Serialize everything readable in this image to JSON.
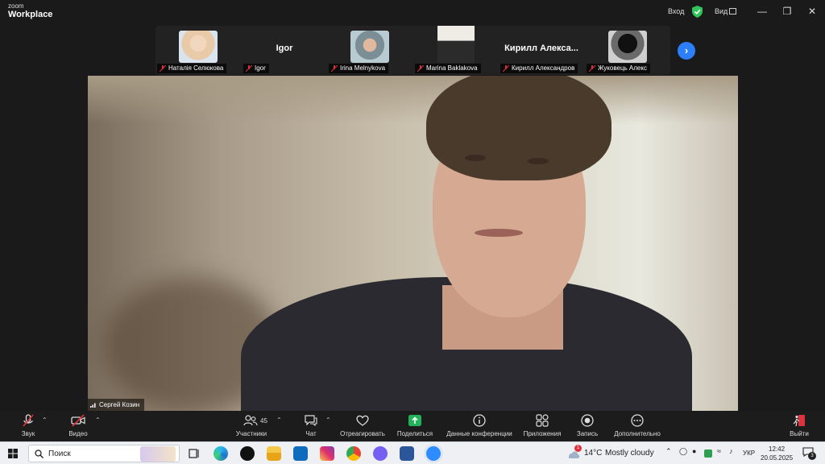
{
  "app": {
    "logo_top": "zoom",
    "logo_main": "Workplace"
  },
  "titlebar": {
    "login": "Вход",
    "view": "Вид",
    "shield_color": "#2ec55b"
  },
  "participants": [
    {
      "name": "Наталія Селюкова",
      "display": "photo",
      "thumb_color": "#e8c9a8"
    },
    {
      "name": "Igor",
      "display": "Igor",
      "thumb_color": ""
    },
    {
      "name": "Irina Melnykova",
      "display": "photo",
      "thumb_color": "#9fb8c4"
    },
    {
      "name": "Marina Baklakova",
      "display": "photo",
      "thumb_color": "#c9c2b4"
    },
    {
      "name": "Кирилл Александров",
      "display": "Кирилл  Алекса...",
      "thumb_color": ""
    },
    {
      "name": "Жуковець Алекс",
      "display": "photo",
      "thumb_color": "#3a3a3a"
    }
  ],
  "main_video": {
    "speaker_name": "Сергей Козин"
  },
  "controls": {
    "audio": "Звук",
    "video": "Видео",
    "participants": "Участники",
    "participants_count": "45",
    "chat": "Чат",
    "react": "Отреагировать",
    "share": "Поделиться",
    "meeting_info": "Данные конференции",
    "apps": "Приложения",
    "record": "Запись",
    "more": "Дополнительно",
    "leave": "Выйти",
    "muted_color": "#e0323c",
    "share_color": "#22b35a"
  },
  "taskbar": {
    "search_placeholder": "Поиск",
    "weather_badge": "1",
    "weather_temp": "14°C",
    "weather_desc": "Mostly cloudy",
    "language": "УКР",
    "time": "12:42",
    "date": "20.05.2025",
    "notifications": "3",
    "apps": [
      "task-view",
      "edge",
      "tiktok",
      "file-explorer",
      "outlook",
      "instagram",
      "chrome",
      "viber",
      "word",
      "zoom"
    ]
  }
}
